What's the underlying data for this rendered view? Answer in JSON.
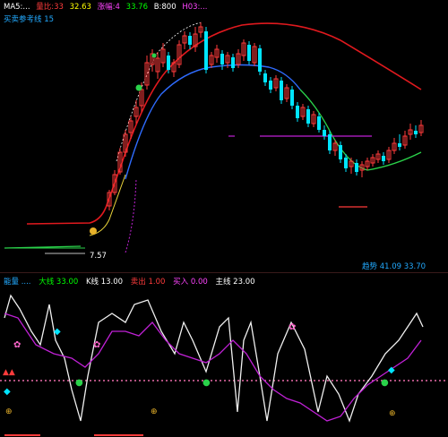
{
  "main_header": {
    "items": [
      {
        "text": "MA5:...",
        "color": "#ffffff"
      },
      {
        "text": "量比:33",
        "color": "#ff3b3b"
      },
      {
        "text": "32.63",
        "color": "#ffff00"
      },
      {
        "text": "涨幅:4",
        "color": "#ff44ff"
      },
      {
        "text": "33.76",
        "color": "#00ff00"
      },
      {
        "text": "B:800",
        "color": "#ffffff"
      },
      {
        "text": "H03:...",
        "color": "#ff44ff"
      }
    ],
    "line2": {
      "text": "买卖参考线 15",
      "color": "#22aaff"
    }
  },
  "right_panel_label": {
    "text": "趋势 41.09 33.70",
    "color": "#22aaff"
  },
  "low_label": {
    "text": "7.57",
    "color": "#ffffff"
  },
  "sub_header": {
    "items": [
      {
        "text": "能量 ....",
        "color": "#22aaff"
      },
      {
        "text": "大线 33.00",
        "color": "#00ff00"
      },
      {
        "text": "K线 13.00",
        "color": "#ffffff"
      },
      {
        "text": "卖出 1.00",
        "color": "#ff3b3b"
      },
      {
        "text": "买入 0.00",
        "color": "#ff44ff"
      },
      {
        "text": "主线 23.00",
        "color": "#ffffff"
      }
    ]
  },
  "colors": {
    "up": "#ff3b3b",
    "down": "#00e5ff",
    "red_line": "#e0191e",
    "blue_line": "#2f6cff",
    "green_line": "#2ad24a",
    "magenta": "#c021d6",
    "white": "#f0f0f0"
  }
}
